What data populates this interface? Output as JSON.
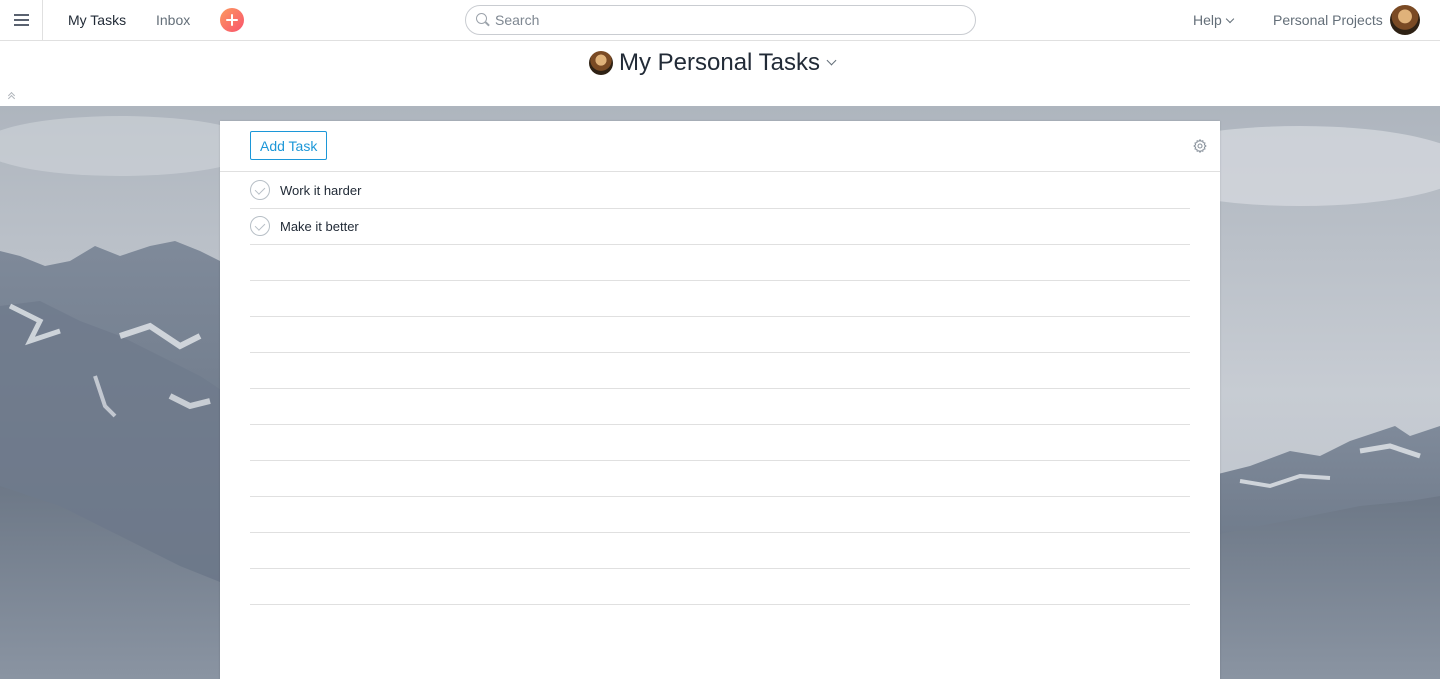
{
  "topbar": {
    "menu_icon": "hamburger-menu-icon",
    "nav": [
      {
        "label": "My Tasks"
      },
      {
        "label": "Inbox"
      }
    ],
    "quick_add_icon": "plus-circle-icon",
    "search": {
      "placeholder": "Search",
      "value": "",
      "icon": "search-icon"
    },
    "help_label": "Help",
    "workspace_label": "Personal Projects",
    "avatar_icon": "user-avatar"
  },
  "header": {
    "title": "My Personal Tasks",
    "avatar_icon": "user-avatar",
    "dropdown_icon": "chevron-down-icon",
    "collapse_icon": "double-chevron-up-icon"
  },
  "panel": {
    "add_task_label": "Add Task",
    "settings_icon": "gear-icon",
    "tasks": [
      {
        "name": "Work it harder",
        "completed": false
      },
      {
        "name": "Make it better",
        "completed": false
      }
    ],
    "empty_rows": 10
  },
  "colors": {
    "accent": "#1c97d8",
    "quick_add_start": "#fc9a5f",
    "quick_add_end": "#f9536d",
    "text": "#222b37",
    "muted": "#646f79",
    "divider": "#e0e0e0"
  }
}
